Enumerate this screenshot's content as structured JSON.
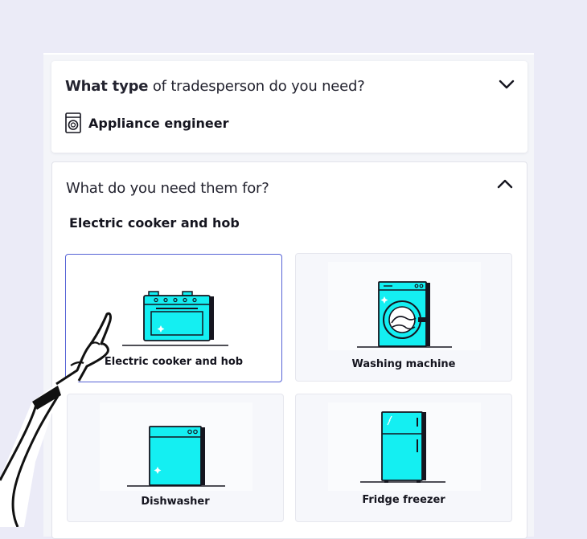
{
  "question1": {
    "bold": "What type",
    "rest": " of tradesperson do you need?"
  },
  "answer1": {
    "label": "Appliance engineer",
    "icon": "washing-machine-icon"
  },
  "question2": {
    "text": "What do you need them for?"
  },
  "selection": "Electric cooker and hob",
  "options": [
    {
      "label": "Electric cooker and  hob",
      "selected": true,
      "icon": "cooker-icon"
    },
    {
      "label": "Washing machine",
      "selected": false,
      "icon": "washing-machine-icon"
    },
    {
      "label": "Dishwasher",
      "selected": false,
      "icon": "dishwasher-icon"
    },
    {
      "label": "Fridge freezer",
      "selected": false,
      "icon": "fridge-freezer-icon"
    }
  ],
  "colors": {
    "accent": "#5663d6",
    "appliance": "#14eff2",
    "background": "#ebebf7"
  }
}
